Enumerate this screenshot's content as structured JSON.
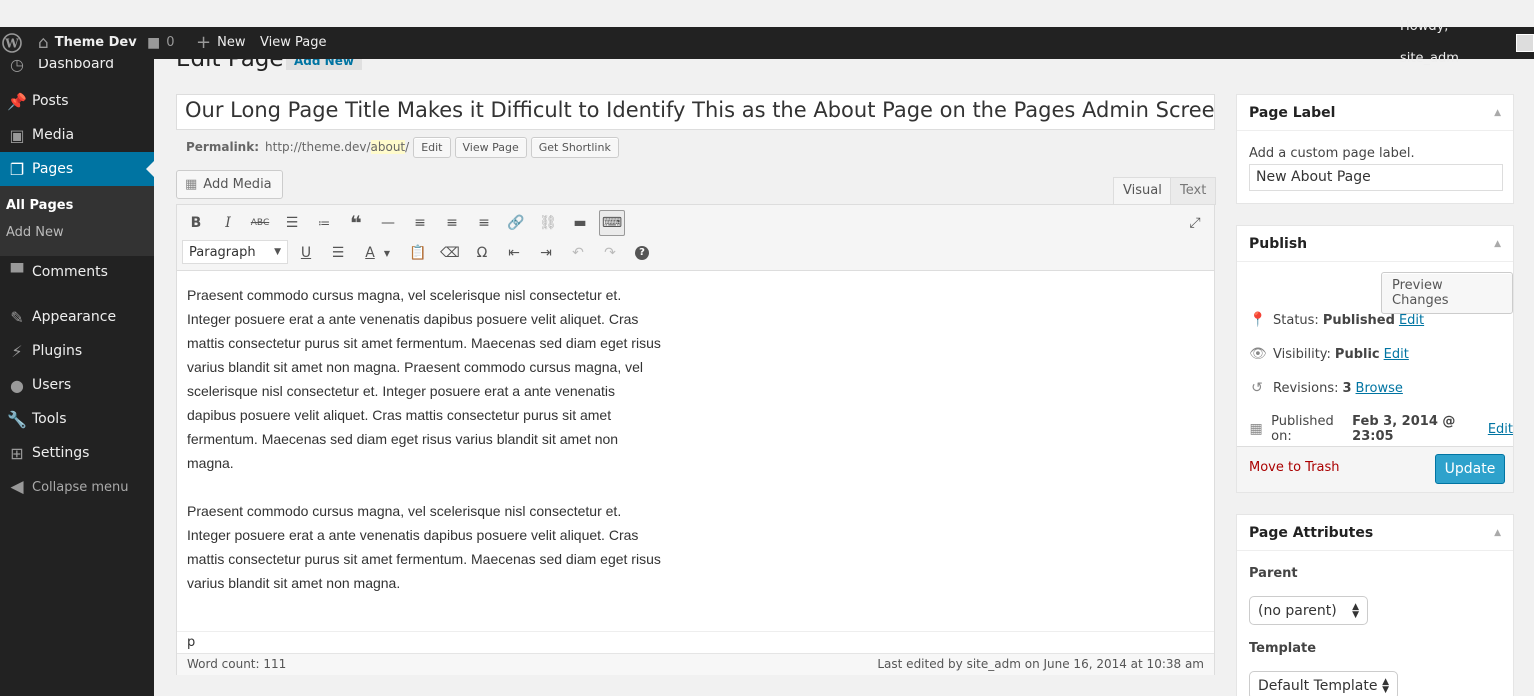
{
  "adminbar": {
    "site_name": "Theme Dev",
    "comments_count": "0",
    "new_label": "New",
    "view_page_label": "View Page",
    "howdy": "Howdy, site_adm"
  },
  "sidebar": {
    "partial_item": "Dashboard",
    "items": [
      {
        "label": "Posts",
        "icon": "pin-icon"
      },
      {
        "label": "Media",
        "icon": "media-icon"
      },
      {
        "label": "Pages",
        "icon": "pages-icon"
      },
      {
        "label": "Comments",
        "icon": "comment-icon"
      },
      {
        "label": "Appearance",
        "icon": "brush-icon"
      },
      {
        "label": "Plugins",
        "icon": "plug-icon"
      },
      {
        "label": "Users",
        "icon": "user-icon"
      },
      {
        "label": "Tools",
        "icon": "wrench-icon"
      },
      {
        "label": "Settings",
        "icon": "settings-icon"
      }
    ],
    "submenu": [
      "All Pages",
      "Add New"
    ],
    "collapse": "Collapse menu"
  },
  "main": {
    "heading": "Edit Page",
    "add_new": "Add New",
    "title_value": "Our Long Page Title Makes it Difficult to Identify This as the About Page on the Pages Admin Screen",
    "permalink_label": "Permalink:",
    "permalink_base": "http://theme.dev/",
    "permalink_slug": "about",
    "permalink_trail": "/",
    "edit_btn": "Edit",
    "view_page_btn": "View Page",
    "shortlink_btn": "Get Shortlink",
    "add_media": "Add Media",
    "tab_visual": "Visual",
    "tab_text": "Text",
    "format_value": "Paragraph",
    "paragraphs": [
      "Praesent commodo cursus magna, vel scelerisque nisl consectetur et. Integer posuere erat a ante venenatis dapibus posuere velit aliquet. Cras mattis consectetur purus sit amet fermentum. Maecenas sed diam eget risus varius blandit sit amet non magna. Praesent commodo cursus magna, vel scelerisque nisl consectetur et. Integer posuere erat a ante venenatis dapibus posuere velit aliquet. Cras mattis consectetur purus sit amet fermentum. Maecenas sed diam eget risus varius blandit sit amet non magna.",
      "Praesent commodo cursus magna, vel scelerisque nisl consectetur et. Integer posuere erat a ante venenatis dapibus posuere velit aliquet. Cras mattis consectetur purus sit amet fermentum. Maecenas sed diam eget risus varius blandit sit amet non magna."
    ],
    "path": "p",
    "word_count": "Word count: 111",
    "last_edited": "Last edited by site_adm on June 16, 2014 at 10:38 am"
  },
  "page_label_box": {
    "title": "Page Label",
    "desc": "Add a custom page label.",
    "value": "New About Page"
  },
  "publish_box": {
    "title": "Publish",
    "preview": "Preview Changes",
    "status_label": "Status:",
    "status_value": "Published",
    "visibility_label": "Visibility:",
    "visibility_value": "Public",
    "revisions_label": "Revisions:",
    "revisions_value": "3",
    "browse": "Browse",
    "published_label": "Published on:",
    "published_value": "Feb 3, 2014 @ 23:05",
    "edit": "Edit",
    "trash": "Move to Trash",
    "update": "Update"
  },
  "attributes_box": {
    "title": "Page Attributes",
    "parent_label": "Parent",
    "parent_value": "(no parent)",
    "template_label": "Template",
    "template_value": "Default Template"
  },
  "colors": {
    "admin_dark": "#222222",
    "accent_blue": "#0074a2",
    "update_button": "#2ea2cc",
    "trash_red": "#a00000"
  }
}
